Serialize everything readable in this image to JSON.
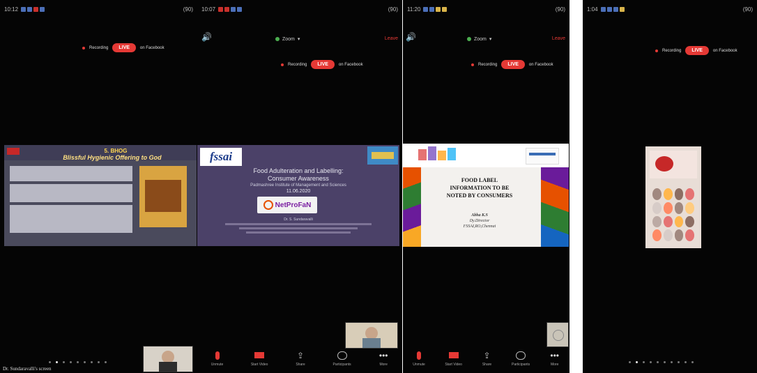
{
  "screens": [
    {
      "status_time": "10:12",
      "status_battery": "(90)",
      "recording_label": "Recording",
      "live_label": "LIVE",
      "facebook_label": "on Facebook",
      "slide": {
        "title": "5. BHOG",
        "subtitle": "Blissful Hygienic Offering to God"
      },
      "caption": "Dr. Sundaravalli's screen"
    },
    {
      "status_time": "10:07",
      "status_battery": "(90)",
      "zoom_label": "Zoom",
      "leave_label": "Leave",
      "recording_label": "Recording",
      "live_label": "LIVE",
      "facebook_label": "on Facebook",
      "slide": {
        "logo": "fssai",
        "title_line1": "Food Adulteration and Labelling:",
        "title_line2": "Consumer Awareness",
        "institute": "Padmashree Institute of Management and Sciences",
        "date": "11.06.2020",
        "brand": "NetProFaN",
        "presenter": "Dr. S. Sundaravalli"
      },
      "toolbar": [
        "Unmute",
        "Start Video",
        "Share",
        "Participants",
        "More"
      ]
    },
    {
      "status_time": "11:20",
      "status_battery": "(90)",
      "zoom_label": "Zoom",
      "leave_label": "Leave",
      "recording_label": "Recording",
      "live_label": "LIVE",
      "facebook_label": "on Facebook",
      "slide": {
        "title_line1": "FOOD LABEL",
        "title_line2": "INFORMATION TO BE",
        "title_line3": "NOTED BY CONSUMERS",
        "author": "Abha K.S",
        "role": "Dy.Director",
        "org": "FSSAI,RO,Chennai"
      },
      "toolbar": [
        "Unmute",
        "Start Video",
        "Share",
        "Participants",
        "More"
      ]
    },
    {
      "status_time": "1:04",
      "status_battery": "(90)",
      "recording_label": "Recording",
      "live_label": "LIVE",
      "facebook_label": "on Facebook"
    }
  ]
}
